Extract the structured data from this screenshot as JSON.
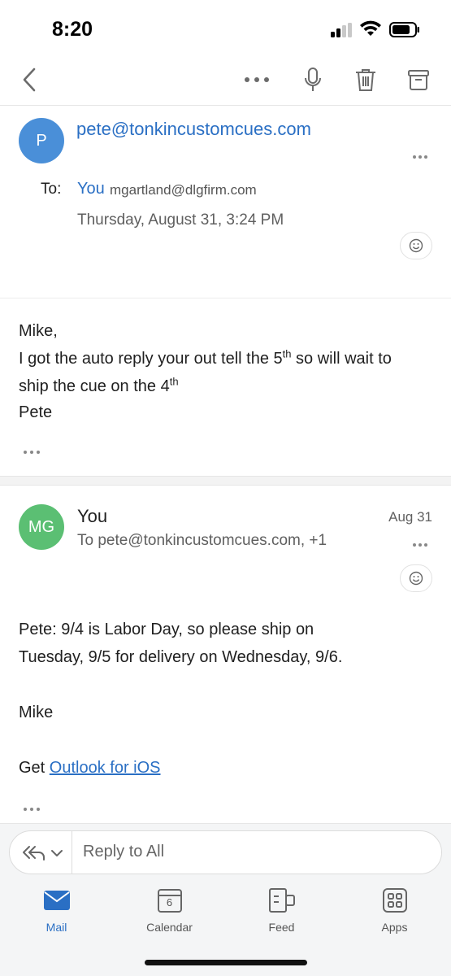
{
  "status_bar": {
    "time": "8:20"
  },
  "message1": {
    "avatar_initial": "P",
    "sender": "pete@tonkincustomcues.com",
    "to_label": "To:",
    "to_name": "You",
    "to_address": "mgartland@dlgfirm.com",
    "date": "Thursday, August 31, 3:24 PM",
    "greeting": "Mike,",
    "line1_a": "I got the auto reply your out tell the 5",
    "line1_sup": "th",
    "line1_b": " so will wait to",
    "line2_a": "ship the cue on the 4",
    "line2_sup": "th",
    "signoff": "Pete"
  },
  "message2": {
    "avatar_initials": "MG",
    "sender": "You",
    "recipients": "To pete@tonkincustomcues.com, +1",
    "date": "Aug 31",
    "para1_line1": "Pete:  9/4 is Labor Day, so please ship on",
    "para1_line2": "Tuesday, 9/5 for delivery on Wednesday, 9/6.",
    "signoff": "Mike",
    "get_prefix": "Get ",
    "get_link": "Outlook for iOS"
  },
  "reply": {
    "placeholder": "Reply to All"
  },
  "tabs": [
    {
      "label": "Mail",
      "icon": "mail-icon"
    },
    {
      "label": "Calendar",
      "icon": "calendar-icon",
      "badge": "6"
    },
    {
      "label": "Feed",
      "icon": "feed-icon"
    },
    {
      "label": "Apps",
      "icon": "apps-icon"
    }
  ],
  "colors": {
    "accent": "#2a6fc4",
    "avatar_p": "#4a8fd8",
    "avatar_mg": "#5bbf73"
  }
}
